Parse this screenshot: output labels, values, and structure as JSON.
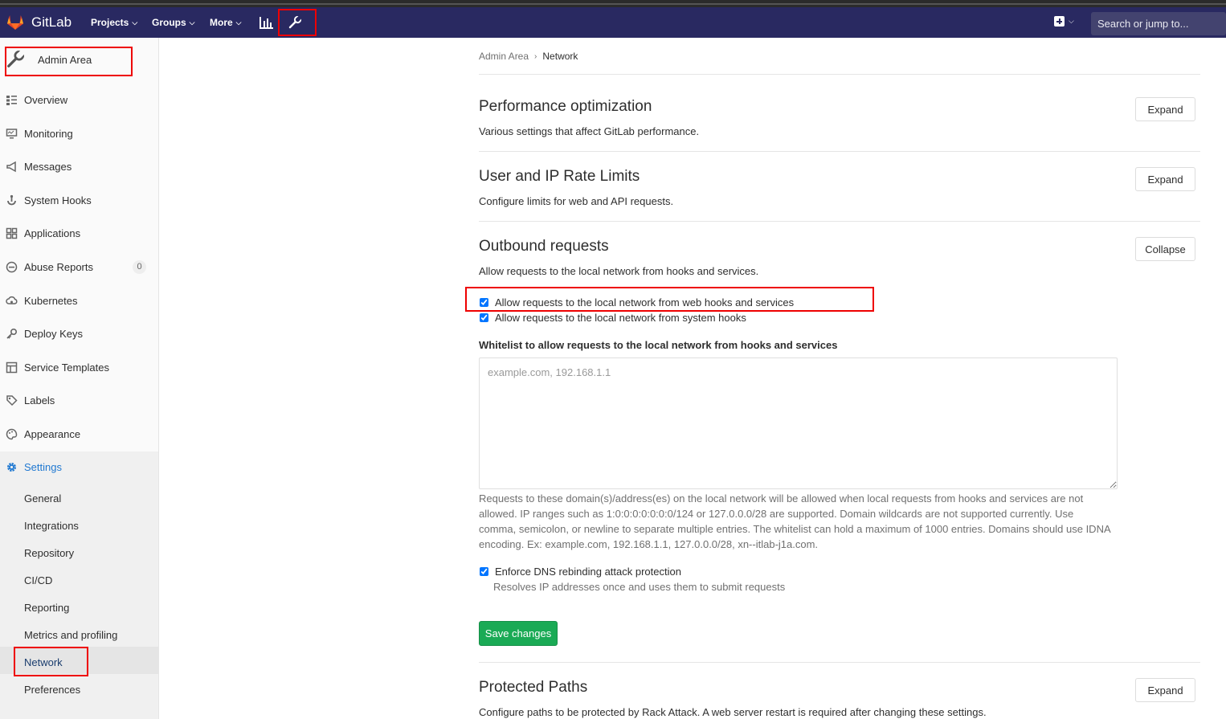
{
  "navbar": {
    "brand": "GitLab",
    "projects": "Projects",
    "groups": "Groups",
    "more": "More",
    "search_placeholder": "Search or jump to..."
  },
  "sidebar": {
    "header": "Admin Area",
    "items": [
      {
        "label": "Overview",
        "icon": "overview-icon"
      },
      {
        "label": "Monitoring",
        "icon": "monitor-icon"
      },
      {
        "label": "Messages",
        "icon": "bullhorn-icon"
      },
      {
        "label": "System Hooks",
        "icon": "hook-icon"
      },
      {
        "label": "Applications",
        "icon": "applications-icon"
      },
      {
        "label": "Abuse Reports",
        "icon": "abuse-icon",
        "badge": "0"
      },
      {
        "label": "Kubernetes",
        "icon": "cloud-gear-icon"
      },
      {
        "label": "Deploy Keys",
        "icon": "key-icon"
      },
      {
        "label": "Service Templates",
        "icon": "template-icon"
      },
      {
        "label": "Labels",
        "icon": "label-icon"
      },
      {
        "label": "Appearance",
        "icon": "palette-icon"
      },
      {
        "label": "Settings",
        "icon": "gear-icon"
      }
    ],
    "settings_sub": [
      "General",
      "Integrations",
      "Repository",
      "CI/CD",
      "Reporting",
      "Metrics and profiling",
      "Network",
      "Preferences"
    ]
  },
  "breadcrumb": {
    "parent": "Admin Area",
    "current": "Network"
  },
  "sections": {
    "performance": {
      "title": "Performance optimization",
      "desc": "Various settings that affect GitLab performance.",
      "button": "Expand"
    },
    "rate_limits": {
      "title": "User and IP Rate Limits",
      "desc": "Configure limits for web and API requests.",
      "button": "Expand"
    },
    "outbound": {
      "title": "Outbound requests",
      "desc": "Allow requests to the local network from hooks and services.",
      "button": "Collapse",
      "chk_web_hooks": "Allow requests to the local network from web hooks and services",
      "chk_system_hooks": "Allow requests to the local network from system hooks",
      "whitelist_label": "Whitelist to allow requests to the local network from hooks and services",
      "whitelist_placeholder": "example.com, 192.168.1.1",
      "whitelist_help": "Requests to these domain(s)/address(es) on the local network will be allowed when local requests from hooks and services are not allowed. IP ranges such as 1:0:0:0:0:0:0:0/124 or 127.0.0.0/28 are supported. Domain wildcards are not supported currently. Use comma, semicolon, or newline to separate multiple entries. The whitelist can hold a maximum of 1000 entries. Domains should use IDNA encoding. Ex: example.com, 192.168.1.1, 127.0.0.0/28, xn--itlab-j1a.com.",
      "chk_dns": "Enforce DNS rebinding attack protection",
      "dns_help": "Resolves IP addresses once and uses them to submit requests",
      "save": "Save changes"
    },
    "protected": {
      "title": "Protected Paths",
      "desc": "Configure paths to be protected by Rack Attack. A web server restart is required after changing these settings.",
      "button": "Expand"
    }
  },
  "colors": {
    "navbar": "#292961",
    "save": "#1aaa55",
    "highlight": "#ee0000"
  }
}
